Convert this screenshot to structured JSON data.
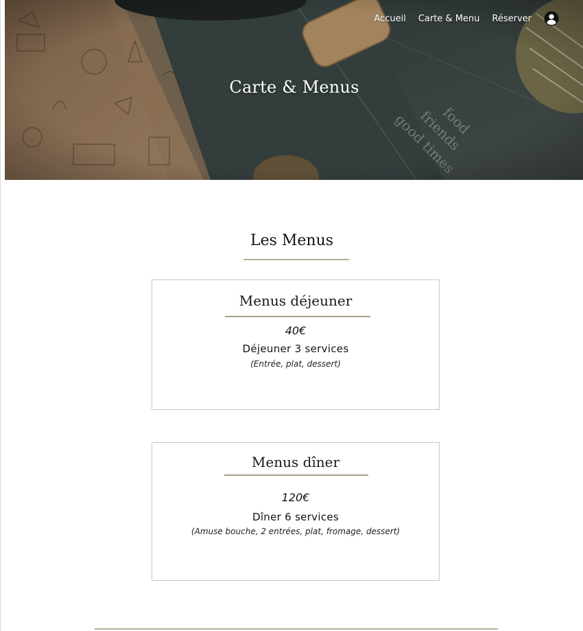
{
  "nav": {
    "links": [
      "Accueil",
      "Carte & Menu",
      "Réserver"
    ],
    "account_icon": "user-circle-icon"
  },
  "hero": {
    "title": "Carte & Menus"
  },
  "section": {
    "title": "Les Menus"
  },
  "menus": [
    {
      "title": "Menus déjeuner",
      "price": "40€",
      "name": "Déjeuner 3 services",
      "description": "(Entrée, plat, dessert)"
    },
    {
      "title": "Menus dîner",
      "price": "120€",
      "name": "Dîner 6 services",
      "description": "(Amuse bouche, 2 entrées, plat, fromage, dessert)"
    }
  ],
  "colors": {
    "accent_rule": "#b8ae9a",
    "card_border": "#c8c8c8",
    "text": "#111111"
  }
}
